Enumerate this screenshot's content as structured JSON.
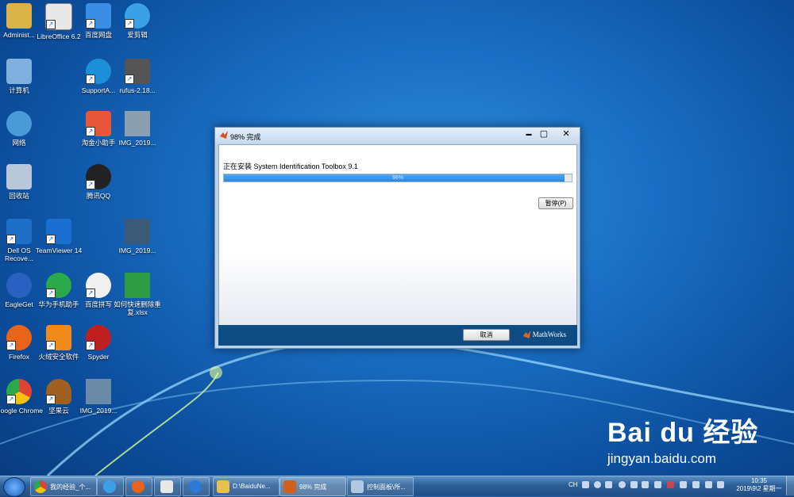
{
  "desktop": {
    "icons": [
      {
        "label": "Administ...",
        "color": "#d9b24a"
      },
      {
        "label": "LibreOffice 6.2",
        "color": "#e8e8e8"
      },
      {
        "label": "百度网盘",
        "color": "#3a8ee6"
      },
      {
        "label": "爱剪辑",
        "color": "#3aa0e8"
      },
      {
        "label": "计算机",
        "color": "#7fb0e0"
      },
      {
        "label": "SupportA...",
        "color": "#1d8fd8"
      },
      {
        "label": "rufus-2.18...",
        "color": "#555555"
      },
      {
        "label": "网络",
        "color": "#4a9ad8"
      },
      {
        "label": "淘金小助手",
        "color": "#e8563a"
      },
      {
        "label": "IMG_2019...",
        "color": "#8aa0b0"
      },
      {
        "label": "回收站",
        "color": "#b8c8d8"
      },
      {
        "label": "腾讯QQ",
        "color": "#222222"
      },
      {
        "label": "Dell OS Recove...",
        "color": "#1e6fc8"
      },
      {
        "label": "TeamViewer 14",
        "color": "#1a6fd0"
      },
      {
        "label": "IMG_2019...",
        "color": "#3a5a78"
      },
      {
        "label": "EagleGet",
        "color": "#2a60c0"
      },
      {
        "label": "华为手机助手",
        "color": "#2ba84a"
      },
      {
        "label": "百度拼写",
        "color": "#f0f0f0"
      },
      {
        "label": "如何快速删除重复.xlsx",
        "color": "#2e9b45"
      },
      {
        "label": "Firefox",
        "color": "#e8641a"
      },
      {
        "label": "火绒安全软件",
        "color": "#f08a1a"
      },
      {
        "label": "Spyder",
        "color": "#c02020"
      },
      {
        "label": "Google Chrome",
        "color": "#dd4433"
      },
      {
        "label": "坚果云",
        "color": "#a06020"
      },
      {
        "label": "IMG_2019...",
        "color": "#6a8aa8"
      }
    ]
  },
  "window": {
    "title": "98% 完成",
    "minimize": "▬",
    "maximize": "▢",
    "close": "✕",
    "install_label": "正在安装 System Identification Toolbox 9.1",
    "progress_percent": 98,
    "progress_text": "98%",
    "pause_button": "暂停(P)",
    "cancel_button": "取消",
    "brand": "MathWorks"
  },
  "watermark": {
    "main": "Bai du 经验",
    "url": "jingyan.baidu.com"
  },
  "taskbar": {
    "items": [
      {
        "label": "我的经验_个...",
        "color": "#dd4433"
      },
      {
        "label": "",
        "color": "#3aa0e8"
      },
      {
        "label": "",
        "color": "#e8641a"
      },
      {
        "label": "",
        "color": "#e8e8e8"
      },
      {
        "label": "",
        "color": "#2a7ad8"
      },
      {
        "label": "D:\\BaiduNe...",
        "color": "#e8c050"
      },
      {
        "label": "98% 完成",
        "color": "#d06020"
      },
      {
        "label": "控制面板\\所...",
        "color": "#b0c8e0"
      }
    ],
    "ime": "CH",
    "time": "10:35",
    "date": "2019\\9\\2 星期一"
  }
}
